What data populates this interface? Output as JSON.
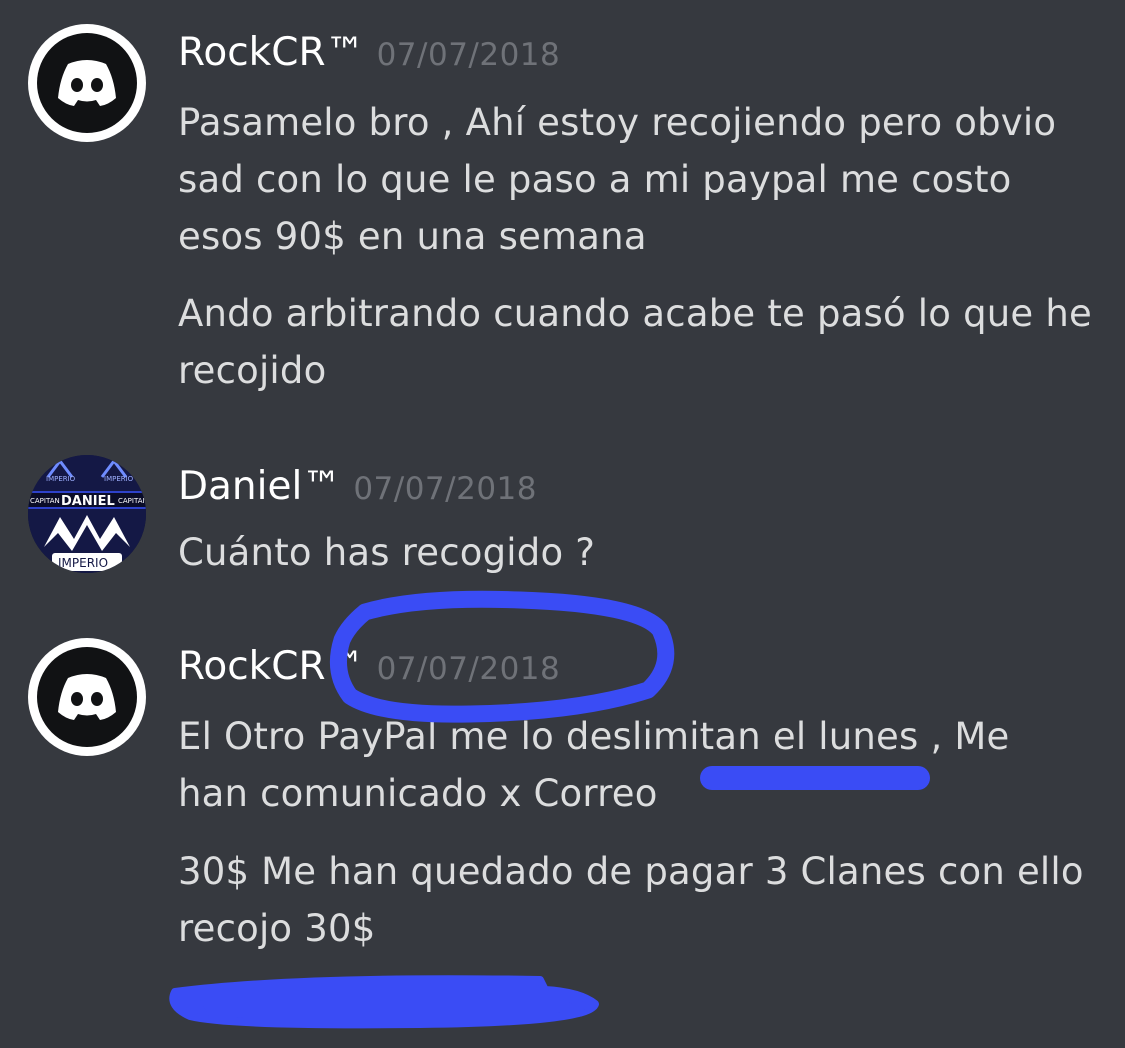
{
  "messages": [
    {
      "author": "RockCR™",
      "timestamp": "07/07/2018",
      "avatar": "discord-logo-icon",
      "lines": [
        "Pasamelo bro , Ahí estoy recojiendo pero obvio",
        "sad con lo que le paso a mi paypal me costo",
        "esos 90$ en una semana",
        "Ando arbitrando cuando acabe te pasó lo que he",
        "recojido"
      ]
    },
    {
      "author": "Daniel™",
      "timestamp": "07/07/2018",
      "avatar": "daniel-imperio-avatar",
      "avatar_text": {
        "top_left": "IMPERIO",
        "top_right": "IMPERIO",
        "left": "CAPITAN",
        "name": "DANIEL",
        "right": "CAPITAN",
        "bottom": "IMPERIO"
      },
      "lines": [
        "Cuánto has recogido ?"
      ]
    },
    {
      "author": "RockCR™",
      "timestamp": "07/07/2018",
      "avatar": "discord-logo-icon",
      "lines": [
        "El Otro PayPal me lo deslimitan el lunes , Me",
        "han comunicado x Correo",
        "30$ Me han quedado de pagar 3 Clanes con ello",
        "recojo 30$"
      ]
    }
  ],
  "colors": {
    "background": "#36393f",
    "username": "#ffffff",
    "message_text": "#dcddde",
    "timestamp": "#6f7278",
    "annotation_marker": "#3a4cf5"
  }
}
